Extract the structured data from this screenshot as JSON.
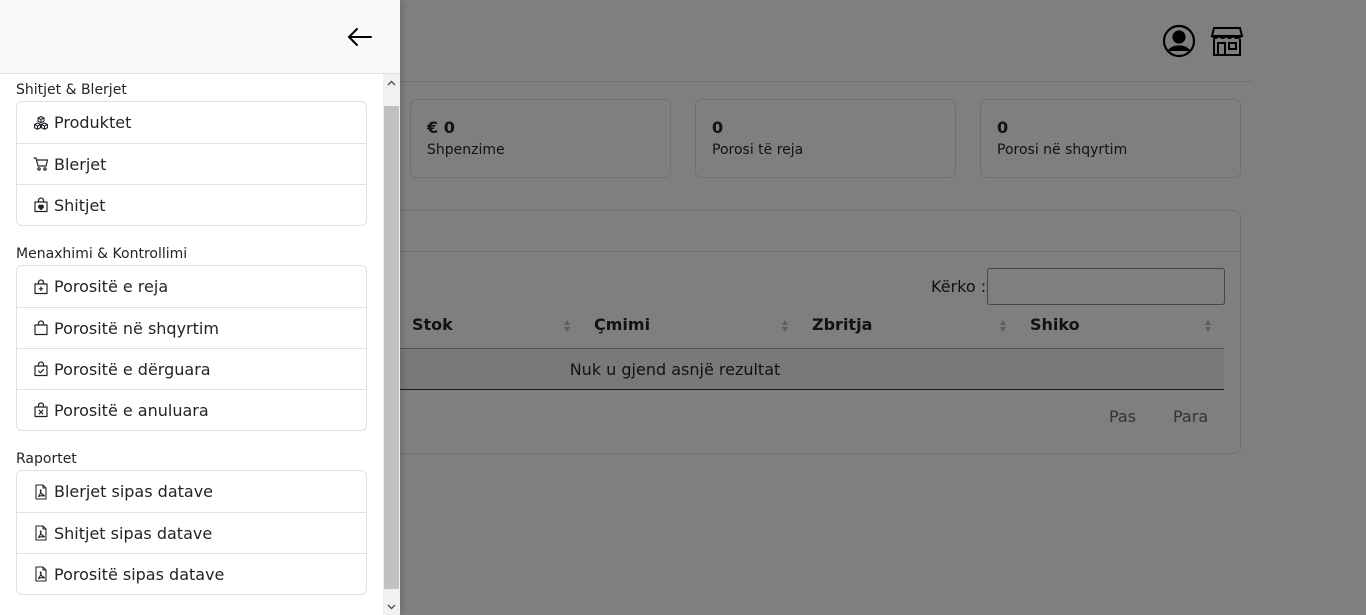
{
  "sidebar": {
    "sections": [
      {
        "title": "Shitjet & Blerjet",
        "items": [
          {
            "label": "Produktet",
            "icon": "boxes-icon"
          },
          {
            "label": "Blerjet",
            "icon": "cart-icon"
          },
          {
            "label": "Shitjet",
            "icon": "bag-heart-icon"
          }
        ]
      },
      {
        "title": "Menaxhimi & Kontrollimi",
        "items": [
          {
            "label": "Porositë e reja",
            "icon": "bag-plus-icon"
          },
          {
            "label": "Porositë në shqyrtim",
            "icon": "bag-icon"
          },
          {
            "label": "Porositë e dërguara",
            "icon": "bag-check-icon"
          },
          {
            "label": "Porositë e anuluara",
            "icon": "bag-x-icon"
          }
        ]
      },
      {
        "title": "Raportet",
        "items": [
          {
            "label": "Blerjet sipas datave",
            "icon": "file-pdf-icon"
          },
          {
            "label": "Shitjet sipas datave",
            "icon": "file-pdf-icon"
          },
          {
            "label": "Porositë sipas datave",
            "icon": "file-pdf-icon"
          }
        ]
      }
    ]
  },
  "header": {
    "icons": [
      "user-circle-icon",
      "shop-icon"
    ]
  },
  "stats": [
    {
      "value": "€ 0",
      "label": "Shpenzime"
    },
    {
      "value": "0",
      "label": "Porosi të reja"
    },
    {
      "value": "0",
      "label": "Porosi në shqyrtim"
    }
  ],
  "table": {
    "search_label": "Kërko :",
    "columns": [
      "Stok",
      "Çmimi",
      "Zbritja",
      "Shiko"
    ],
    "empty_message": "Nuk u gjend asnjë rezultat",
    "prev_label": "Pas",
    "next_label": "Para"
  },
  "colors": {
    "overlay": "#000000",
    "border": "#dee2e6",
    "sidebar_header_bg": "#f8f9fa"
  }
}
